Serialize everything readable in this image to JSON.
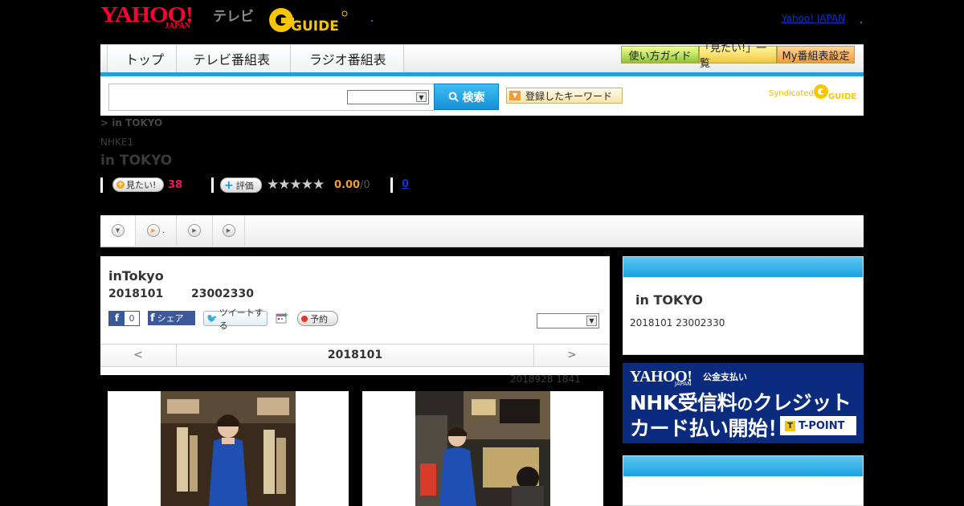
{
  "header": {
    "yahoo_logo": "YAHOO!",
    "yahoo_logo_sub": "JAPAN",
    "tv_label": "テレビ",
    "gguide_logo": "GUIDE",
    "yahoo_japan_link": "Yahoo! JAPAN"
  },
  "nav": {
    "tabs": [
      "トップ",
      "テレビ番組表",
      "ラジオ番組表"
    ],
    "right_buttons": [
      "使い方ガイド",
      "「見たい!」一覧",
      "My番組表設定"
    ]
  },
  "search": {
    "input_value": "",
    "select_value": "",
    "button_label": "検索",
    "keyword_button": "登録したキーワード",
    "syndicated_label": "Syndicated",
    "syndicated_logo": "GUIDE"
  },
  "program": {
    "breadcrumb": "> in TOKYO",
    "channel": "NHKE1",
    "title": "in TOKYO",
    "mitai_label": "見たい!",
    "mitai_count": "38",
    "hyoka_label": "評価",
    "stars": "★★★★★",
    "rating": "0.00",
    "rating_max": "/0",
    "comment_count": "0"
  },
  "subtabs": {
    "tab2_suffix": "."
  },
  "detail": {
    "title": "inTokyo",
    "date": "2018101",
    "time": "23002330",
    "fb_count": "0",
    "fb_share": "シェア",
    "tweet": "ツイートする",
    "reserve": "予約",
    "select_value": "",
    "pager_prev": "<",
    "pager_date": "2018101",
    "pager_next": ">",
    "updated": "2018928  1841"
  },
  "sidebar": {
    "title": "in TOKYO",
    "datetime": "2018101  23002330",
    "ad": {
      "logo": "YAHOO!",
      "logo_sub": "JAPAN",
      "kokin": "公金支払い",
      "line1_a": "NHK受信料",
      "line1_b": "の",
      "line1_c": "クレジット",
      "line2": "カード払い開始！",
      "tpoint": "T-POINT",
      "tpoint_t": "T"
    }
  },
  "colors": {
    "accent_blue": "#1aa2e2",
    "yahoo_red": "#ff0033",
    "gguide_yellow": "#f7c600",
    "mitai_pink": "#e8195f",
    "score_orange": "#f29b38"
  }
}
